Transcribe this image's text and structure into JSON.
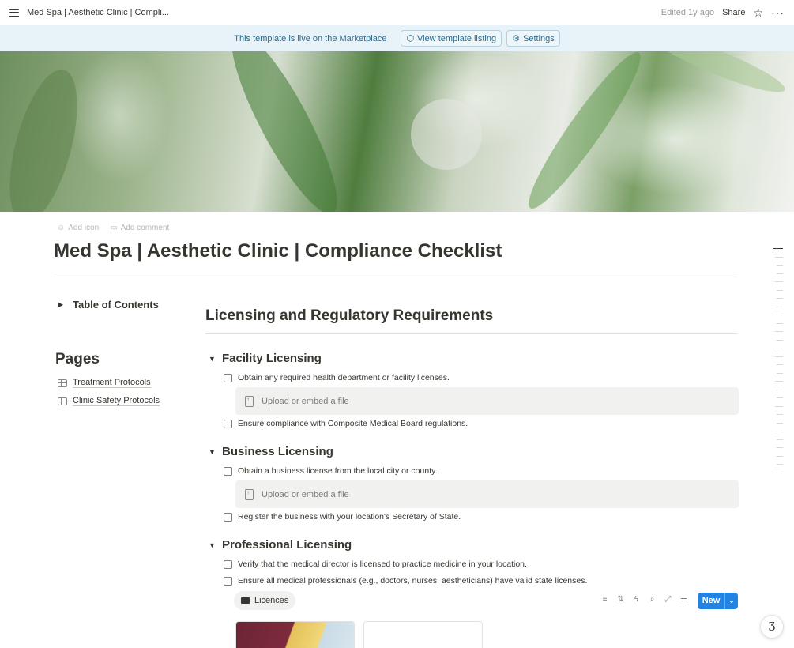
{
  "topbar": {
    "breadcrumb": "Med Spa | Aesthetic Clinic | Compli...",
    "edited": "Edited 1y ago",
    "share": "Share",
    "star_icon": "star-icon",
    "more_icon": "more-horizontal-icon"
  },
  "banner": {
    "text": "This template is live on the Marketplace",
    "view_listing": "View template listing",
    "settings": "Settings"
  },
  "page_meta": {
    "add_icon": "Add icon",
    "add_comment": "Add comment"
  },
  "page": {
    "title": "Med Spa | Aesthetic Clinic | Compliance Checklist"
  },
  "sidebar": {
    "toc": "Table of Contents",
    "pages_heading": "Pages",
    "pages": [
      {
        "label": "Treatment Protocols"
      },
      {
        "label": "Clinic Safety Protocols"
      }
    ]
  },
  "main": {
    "section_heading": "Licensing and Regulatory Requirements",
    "groups": [
      {
        "title": "Facility Licensing",
        "items": [
          "Obtain any required health department or facility licenses.",
          "Ensure compliance with Composite Medical Board regulations."
        ]
      },
      {
        "title": "Business Licensing",
        "items": [
          "Obtain a business license from the local city or county.",
          "Register the business with your location's Secretary of State."
        ]
      },
      {
        "title": "Professional Licensing",
        "items": [
          "Verify that the medical director is licensed to practice medicine in your location.",
          "Ensure all medical professionals (e.g., doctors, nurses, aestheticians) have valid state licenses."
        ]
      }
    ],
    "upload_label": "Upload or embed a file"
  },
  "database": {
    "view_tab": "Licences",
    "new_button": "New",
    "accent": "#2383e2"
  }
}
